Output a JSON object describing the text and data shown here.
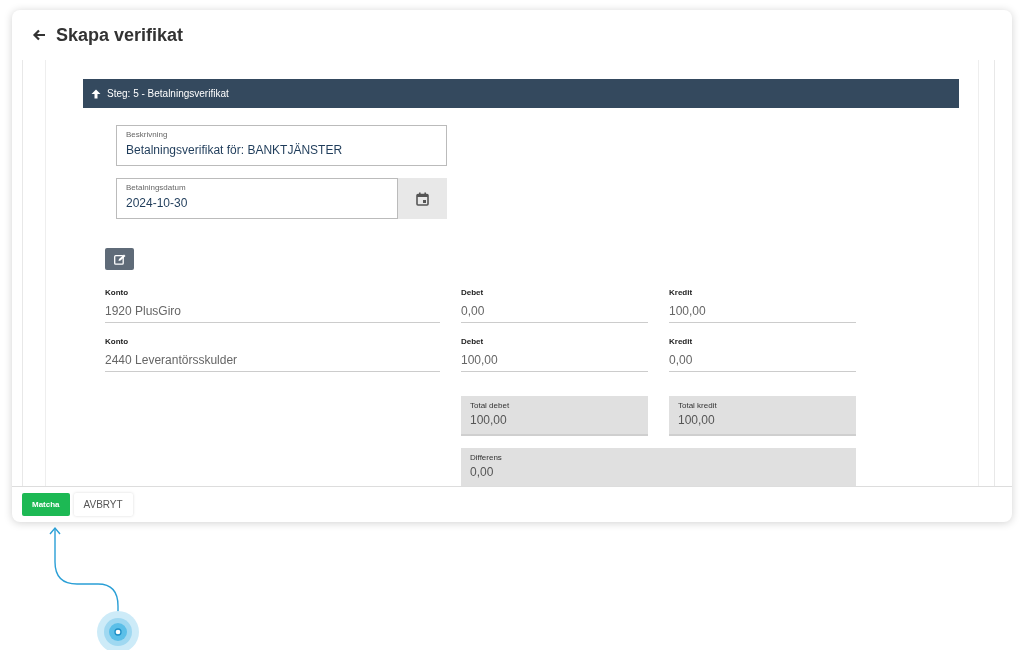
{
  "window": {
    "title": "Skapa verifikat"
  },
  "step_header": "Steg: 5 - Betalningsverifikat",
  "description": {
    "label": "Beskrivning",
    "value": "Betalningsverifikat för: BANKTJÄNSTER"
  },
  "payment_date": {
    "label": "Betalningsdatum",
    "value": "2024-10-30"
  },
  "rows": [
    {
      "konto_label": "Konto",
      "konto": "1920 PlusGiro",
      "debet_label": "Debet",
      "debet": "0,00",
      "kredit_label": "Kredit",
      "kredit": "100,00"
    },
    {
      "konto_label": "Konto",
      "konto": "2440 Leverantörsskulder",
      "debet_label": "Debet",
      "debet": "100,00",
      "kredit_label": "Kredit",
      "kredit": "0,00"
    }
  ],
  "totals": [
    {
      "label": "Total debet",
      "value": "100,00"
    },
    {
      "label": "Total kredit",
      "value": "100,00"
    }
  ],
  "difference": {
    "label": "Differens",
    "value": "0,00"
  },
  "buttons": [
    {
      "label": "Matcha",
      "kind": "primary"
    },
    {
      "label": "AVBRYT",
      "kind": "secondary"
    }
  ]
}
